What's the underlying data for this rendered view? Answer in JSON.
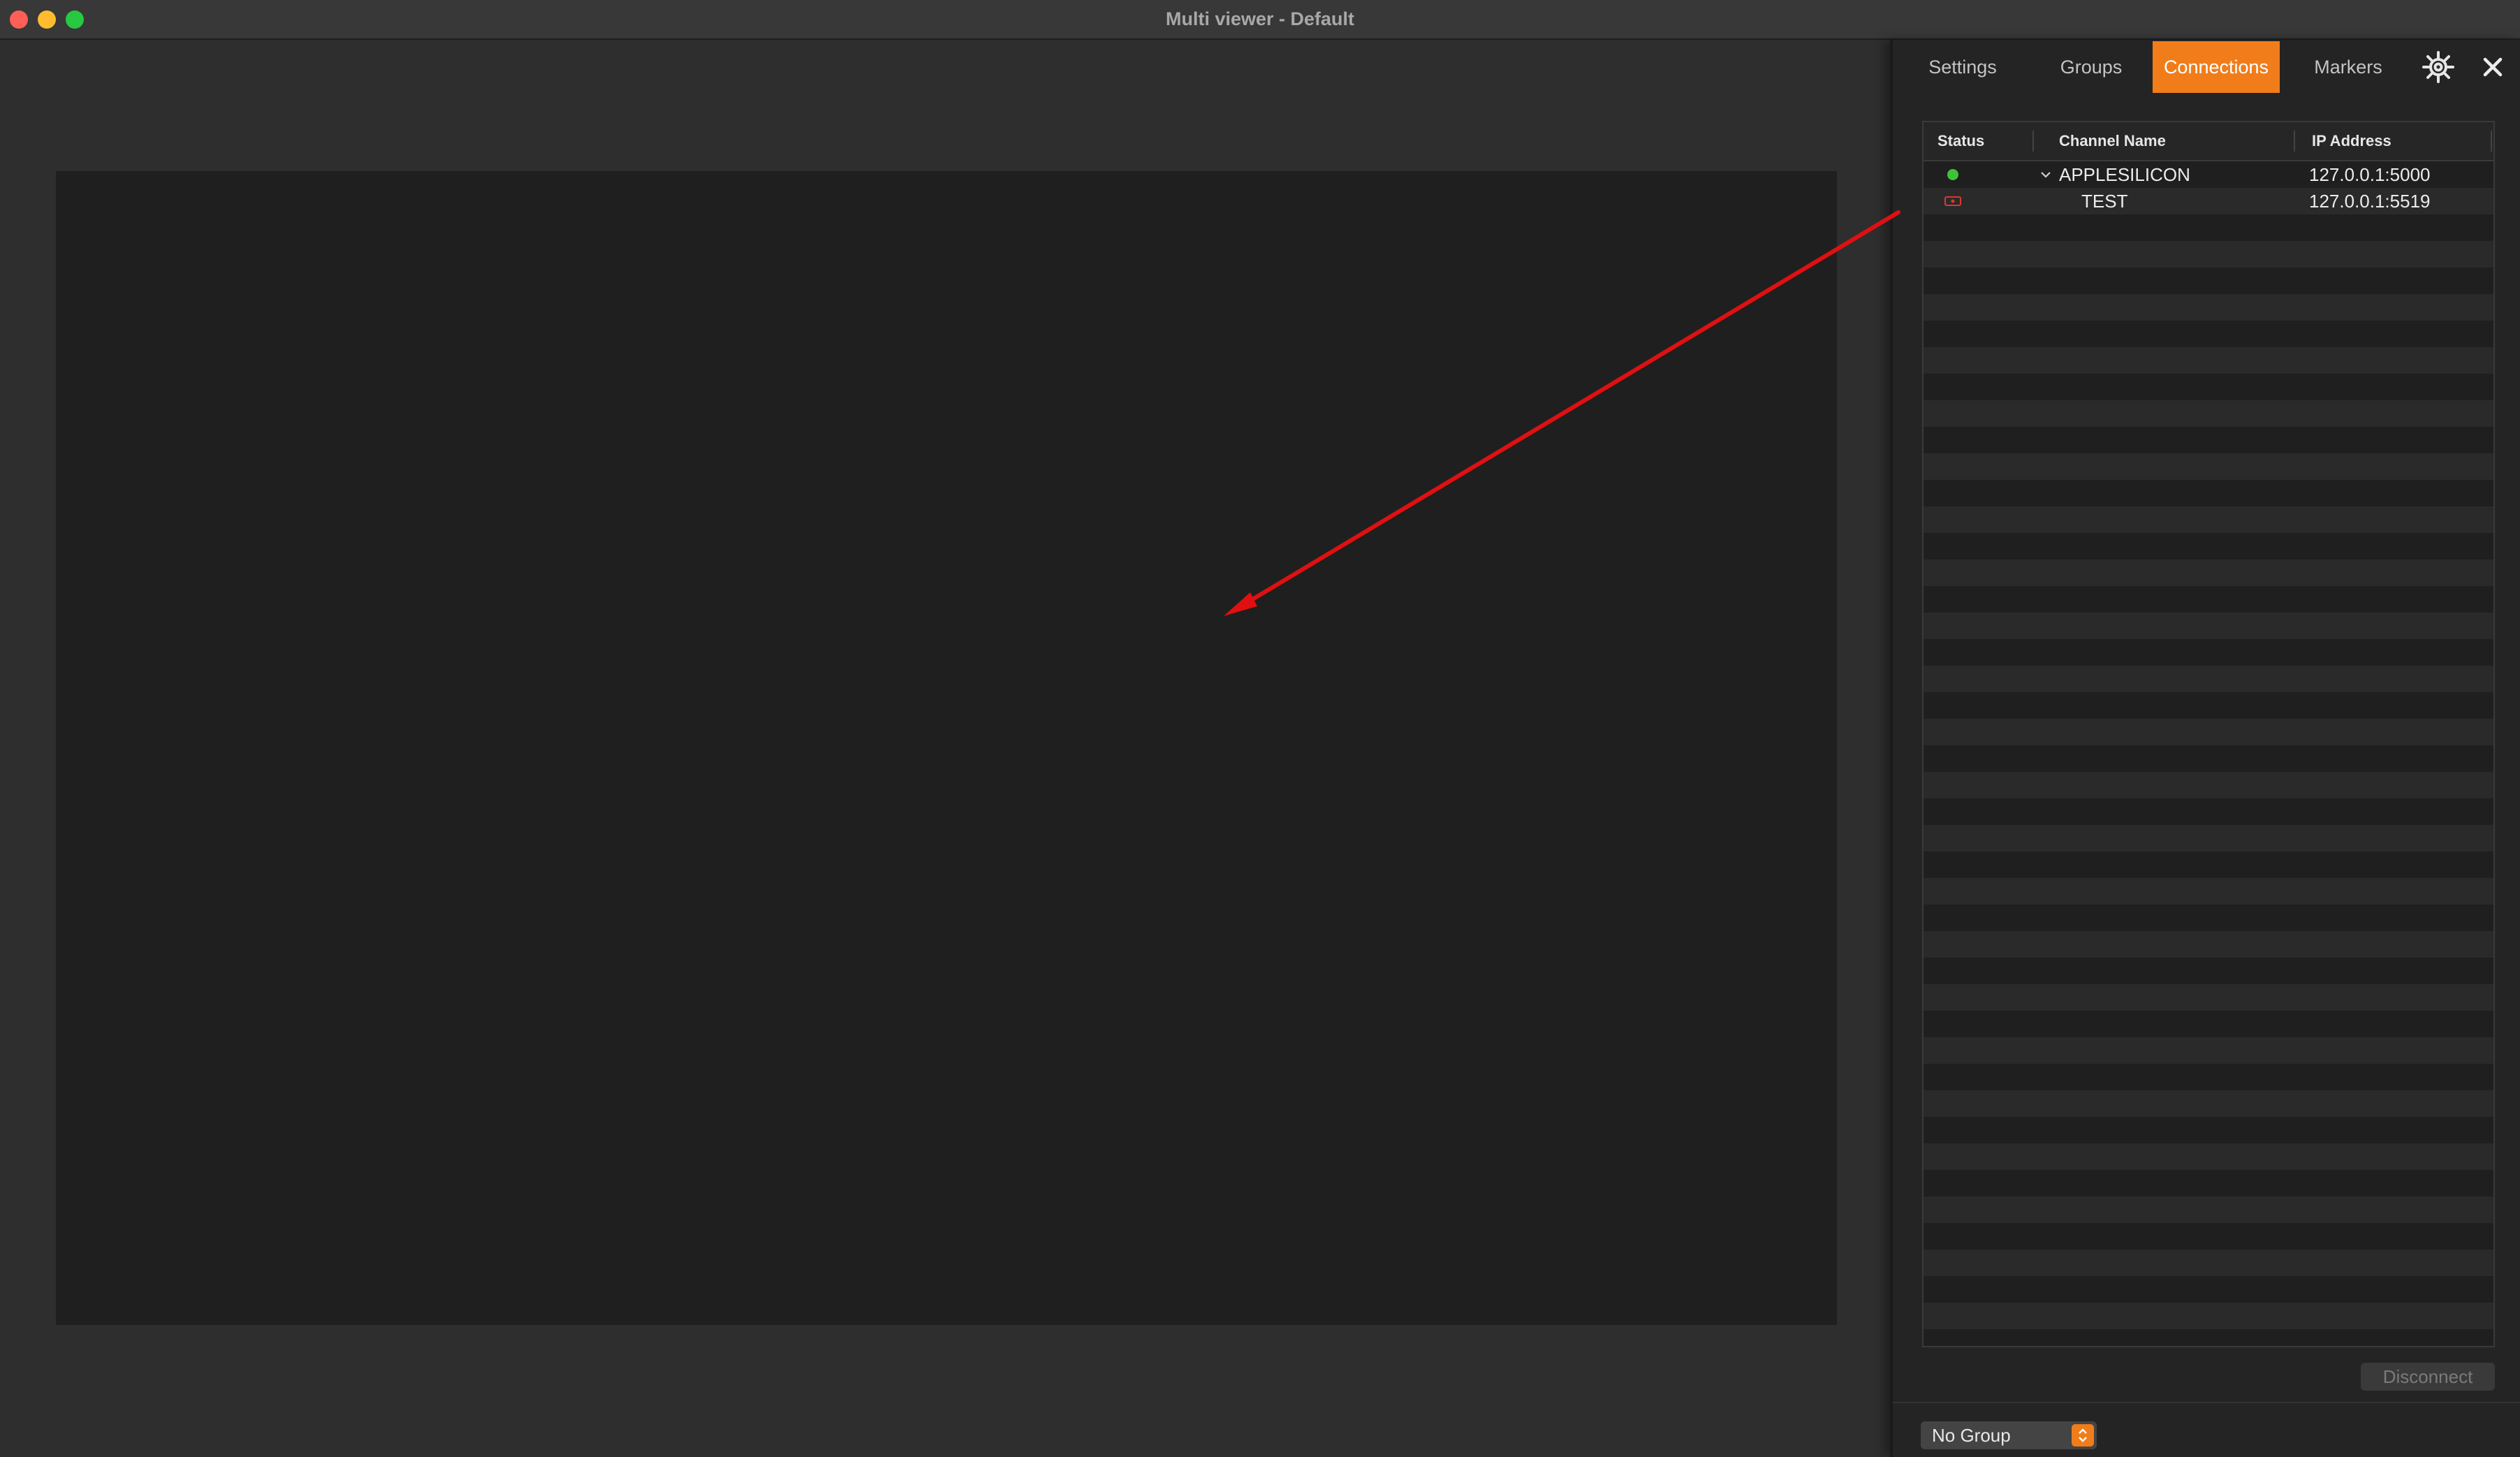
{
  "window": {
    "title": "Multi viewer - Default"
  },
  "tabs": [
    {
      "label": "Settings",
      "active": false
    },
    {
      "label": "Groups",
      "active": false
    },
    {
      "label": "Connections",
      "active": true
    },
    {
      "label": "Markers",
      "active": false
    }
  ],
  "icons": {
    "gear": "gear-icon",
    "close": "close-icon",
    "chevron": "chevron-down-icon",
    "stepper": "up-down-stepper-icon"
  },
  "table": {
    "columns": [
      "Status",
      "Channel Name",
      "IP Address"
    ],
    "rows": [
      {
        "status": "connected",
        "name": "APPLESILICON",
        "ip": "127.0.0.1:5000",
        "expanded": true
      },
      {
        "status": "error",
        "name": "TEST",
        "ip": "127.0.0.1:5519"
      }
    ]
  },
  "buttons": {
    "disconnect": "Disconnect"
  },
  "group_select": {
    "value": "No Group"
  },
  "colors": {
    "accent": "#f07d1a",
    "status_ok": "#3fc23a",
    "status_error": "#d93a2b",
    "annotation": "#e01010"
  }
}
